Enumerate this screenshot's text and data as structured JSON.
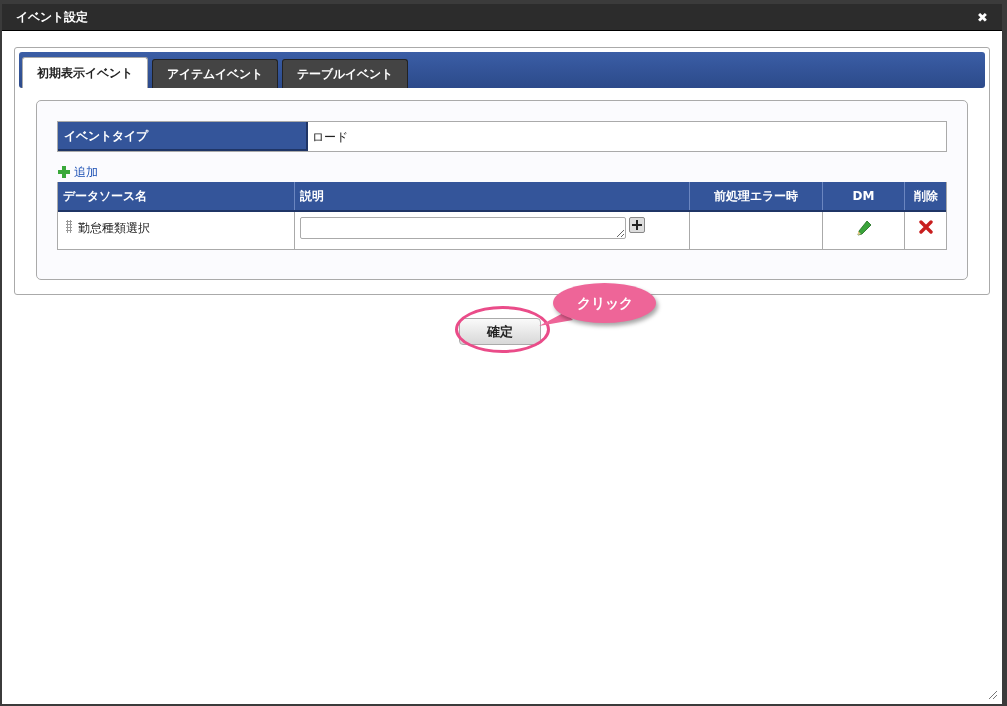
{
  "window": {
    "title": "イベント設定",
    "close": "✖"
  },
  "tabs": [
    {
      "label": "初期表示イベント",
      "selected": true
    },
    {
      "label": "アイテムイベント",
      "selected": false
    },
    {
      "label": "テーブルイベント",
      "selected": false
    }
  ],
  "event_type": {
    "label": "イベントタイプ",
    "value": "ロード"
  },
  "add_link": "追加",
  "table": {
    "columns": [
      "データソース名",
      "説明",
      "前処理エラー時",
      "DM",
      "削除"
    ],
    "rows": [
      {
        "name": "勤怠種類選択",
        "description": ""
      }
    ]
  },
  "confirm_button": "確定",
  "annotation": "クリック"
}
